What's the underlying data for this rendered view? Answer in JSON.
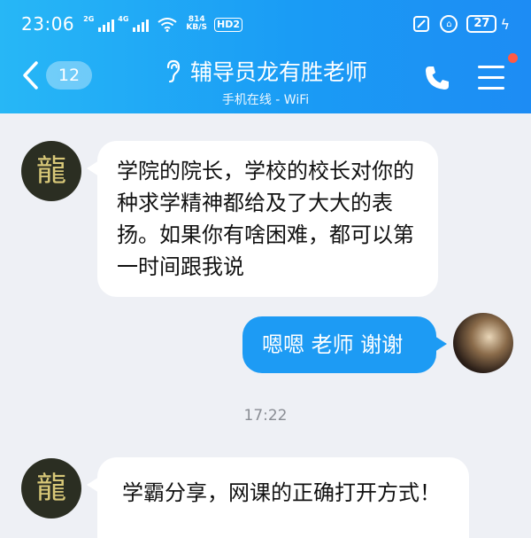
{
  "status_bar": {
    "time": "23:06",
    "sig1_tag": "2G",
    "sig2_tag": "4G",
    "net_speed_value": "814",
    "net_speed_unit": "KB/S",
    "hd_tag": "HD2",
    "battery": "27"
  },
  "header": {
    "back_badge": "12",
    "title": "辅导员龙有胜老师",
    "subtitle": "手机在线 - WiFi",
    "unread_dot_color": "#ff5a44"
  },
  "avatars": {
    "teacher_glyph": "龍"
  },
  "messages": [
    {
      "side": "in",
      "text": "学院的院长，学校的校长对你的种求学精神都给及了大大的表扬。如果你有啥困难，都可以第一时间跟我说"
    },
    {
      "side": "out",
      "text": "嗯嗯 老师 谢谢"
    },
    {
      "side": "in",
      "text": "学霸分享，网课的正确打开方式！"
    }
  ],
  "timestamp": "17:22",
  "colors": {
    "header_blue": "#1a9cf5",
    "bubble_blue": "#1d9bf4",
    "chat_bg": "#eef0f5"
  }
}
